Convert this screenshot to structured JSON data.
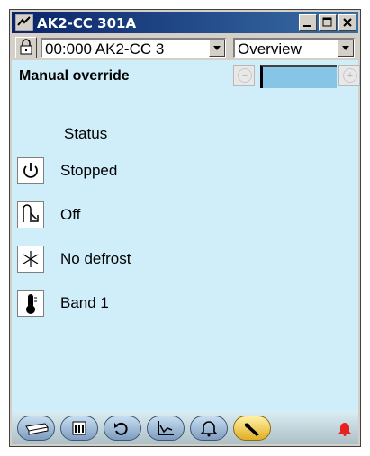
{
  "window": {
    "title": "AK2-CC 301A"
  },
  "toolbar_row": {
    "device_combo": "00:000 AK2-CC 3",
    "view_combo": "Overview"
  },
  "override": {
    "label": "Manual override",
    "value": ""
  },
  "status": {
    "heading": "Status",
    "items": [
      {
        "icon": "power-icon",
        "text": "Stopped"
      },
      {
        "icon": "fan-icon",
        "text": "Off"
      },
      {
        "icon": "snowflake-icon",
        "text": "No defrost"
      },
      {
        "icon": "thermometer-icon",
        "text": "Band 1"
      }
    ]
  },
  "nav": {
    "buttons": [
      "case-icon",
      "calendar-icon",
      "refresh-icon",
      "graph-icon",
      "alarm-icon",
      "wrench-icon"
    ],
    "active": "wrench-icon"
  },
  "colors": {
    "title_bar": "#0a246a",
    "client_bg": "#cfeef9",
    "value_box": "#86c5e6",
    "active_nav": "#e0ae25",
    "alarm_bell": "#e82020"
  }
}
